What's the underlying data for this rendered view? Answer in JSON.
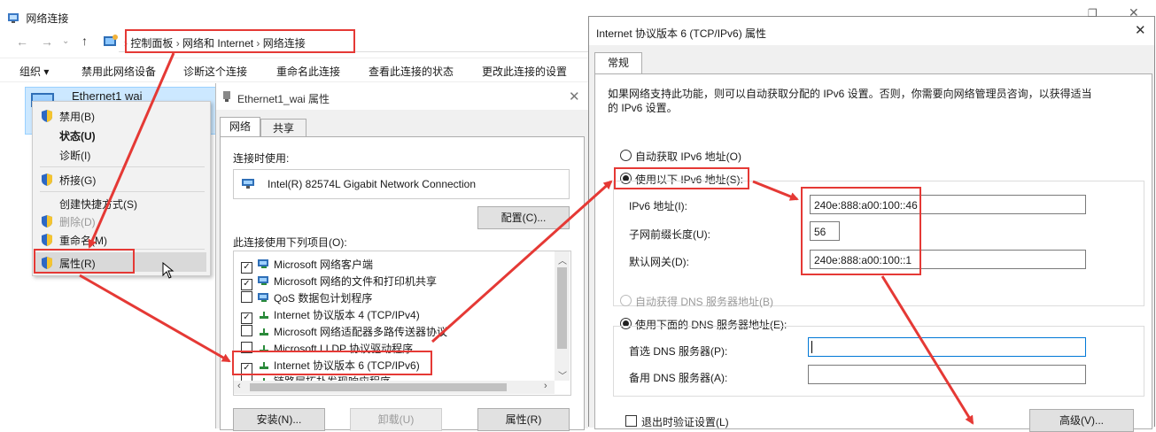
{
  "explorer": {
    "title": "网络连接",
    "breadcrumb": [
      "控制面板",
      "网络和 Internet",
      "网络连接"
    ],
    "toolbar": [
      "组织 ▾",
      "禁用此网络设备",
      "诊断这个连接",
      "重命名此连接",
      "查看此连接的状态",
      "更改此连接的设置"
    ],
    "adapter_name": "Ethernet1 wai"
  },
  "context_menu": {
    "items": [
      "禁用(B)",
      "状态(U)",
      "诊断(I)",
      "桥接(G)",
      "创建快捷方式(S)",
      "删除(D)",
      "重命名(M)",
      "属性(R)"
    ]
  },
  "props_dialog": {
    "title": "Ethernet1_wai 属性",
    "tabs": [
      "网络",
      "共享"
    ],
    "connect_using_label": "连接时使用:",
    "adapter": "Intel(R) 82574L Gigabit Network Connection",
    "config_button": "配置(C)...",
    "items_label": "此连接使用下列项目(O):",
    "items": [
      {
        "label": "Microsoft 网络客户端",
        "checked": true
      },
      {
        "label": "Microsoft 网络的文件和打印机共享",
        "checked": true
      },
      {
        "label": "QoS 数据包计划程序",
        "checked": false
      },
      {
        "label": "Internet 协议版本 4 (TCP/IPv4)",
        "checked": true
      },
      {
        "label": "Microsoft 网络适配器多路传送器协议",
        "checked": false
      },
      {
        "label": "Microsoft LLDP 协议驱动程序",
        "checked": false
      },
      {
        "label": "Internet 协议版本 6 (TCP/IPv6)",
        "checked": true
      },
      {
        "label": "链路层拓扑发现响应程序",
        "checked": false
      }
    ],
    "install_button": "安装(N)...",
    "uninstall_button": "卸载(U)",
    "properties_button": "属性(R)"
  },
  "ipv6_dialog": {
    "title": "Internet 协议版本 6 (TCP/IPv6) 属性",
    "tab": "常规",
    "description_line1": "如果网络支持此功能，则可以自动获取分配的 IPv6 设置。否则，你需要向网络管理员咨询，以获得适当",
    "description_line2": "的 IPv6 设置。",
    "auto_ip": "自动获取 IPv6 地址(O)",
    "manual_ip": "使用以下 IPv6 地址(S):",
    "ipv6_label": "IPv6 地址(I):",
    "ipv6_value": "240e:888:a00:100::46",
    "prefix_label": "子网前缀长度(U):",
    "prefix_value": "56",
    "gateway_label": "默认网关(D):",
    "gateway_value": "240e:888:a00:100::1",
    "auto_dns": "自动获得 DNS 服务器地址(B)",
    "manual_dns": "使用下面的 DNS 服务器地址(E):",
    "preferred_dns_label": "首选 DNS 服务器(P):",
    "preferred_dns_value": "",
    "alternate_dns_label": "备用 DNS 服务器(A):",
    "alternate_dns_value": "",
    "validate_label": "退出时验证设置(L)",
    "advanced_button": "高级(V)...",
    "close_glyph": "✕"
  },
  "colors": {
    "annotation_red": "#e53935",
    "selection": "#cce8ff"
  }
}
